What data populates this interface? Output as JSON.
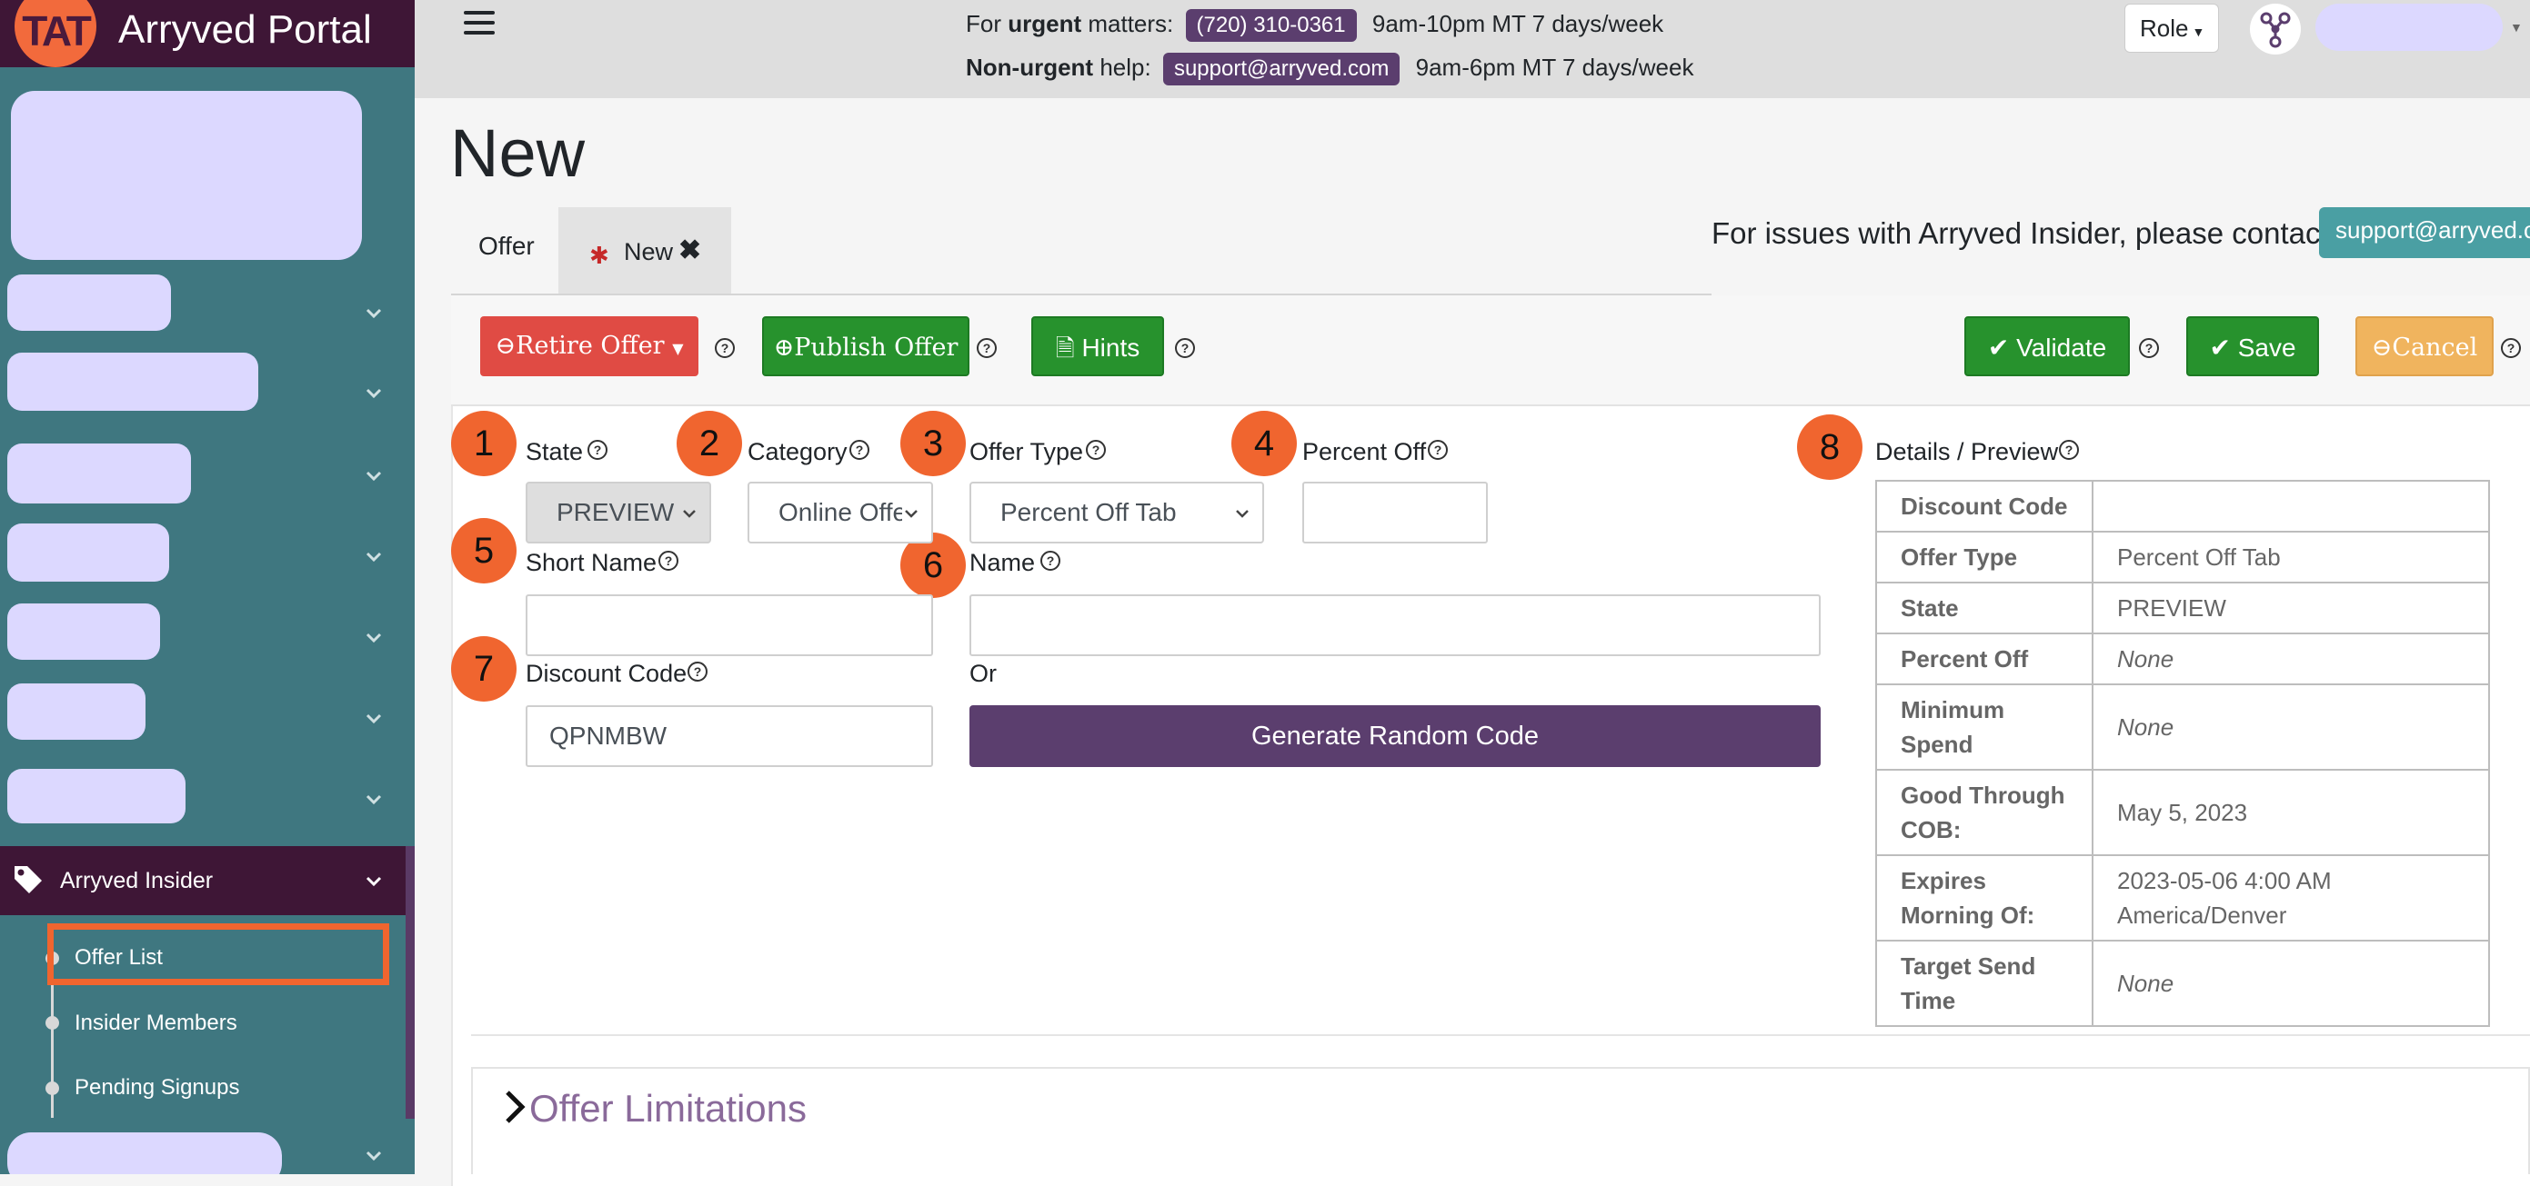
{
  "brand": {
    "title": "Arryved Portal",
    "logo_text": "TAT"
  },
  "sidebar": {
    "section": {
      "label": "Arryved Insider"
    },
    "subitems": [
      {
        "label": "Offer List"
      },
      {
        "label": "Insider Members"
      },
      {
        "label": "Pending Signups"
      }
    ]
  },
  "topbar": {
    "urgent": {
      "prefix": "For ",
      "strong": "urgent",
      "suffix": " matters:",
      "phone": "(720) 310-0361",
      "hours": "9am-10pm MT 7 days/week"
    },
    "nonurgent": {
      "strong": "Non-urgent",
      "suffix": " help:",
      "email": "support@arryved.com",
      "hours": "9am-6pm MT 7 days/week"
    },
    "role_label": "Role"
  },
  "page": {
    "title": "New",
    "tabs": {
      "offer": "Offer",
      "new": "New"
    },
    "issues_text": "For issues with Arryved Insider, please contact",
    "issues_email": "support@arryved.co"
  },
  "toolbar": {
    "retire": "Retire Offer",
    "publish": "Publish Offer",
    "hints": "Hints",
    "validate": "Validate",
    "save": "Save",
    "cancel": "Cancel"
  },
  "markers": [
    "1",
    "2",
    "3",
    "4",
    "5",
    "6",
    "7",
    "8"
  ],
  "form": {
    "state": {
      "label": "State",
      "value": "PREVIEW"
    },
    "category": {
      "label": "Category",
      "value": "Online Offer"
    },
    "offer_type": {
      "label": "Offer Type",
      "value": "Percent Off Tab"
    },
    "percent_off": {
      "label": "Percent Off",
      "value": ""
    },
    "short_name": {
      "label": "Short Name",
      "value": ""
    },
    "name": {
      "label": "Name",
      "value": ""
    },
    "discount_code": {
      "label": "Discount Code",
      "value": "QPNMBW"
    },
    "or_text": "Or",
    "generate_button": "Generate Random Code"
  },
  "details": {
    "title": "Details / Preview",
    "rows": [
      {
        "key": "Discount Code",
        "value": ""
      },
      {
        "key": "Offer Type",
        "value": "Percent Off Tab"
      },
      {
        "key": "State",
        "value": "PREVIEW"
      },
      {
        "key": "Percent Off",
        "value": "None"
      },
      {
        "key": "Minimum Spend",
        "value": "None"
      },
      {
        "key": "Good Through COB:",
        "value": "May 5, 2023"
      },
      {
        "key": "Expires Morning Of:",
        "value": "2023-05-06 4:00 AM America/Denver"
      },
      {
        "key": "Target Send Time",
        "value": "None"
      }
    ]
  },
  "limitations": {
    "label": "Offer Limitations"
  },
  "colors": {
    "brand_dark": "#3e1636",
    "sidebar": "#3f7780",
    "accent": "#f0652f",
    "purple": "#5b3e6e",
    "green": "#27922d",
    "red": "#e04b44",
    "amber": "#f0b45e"
  }
}
